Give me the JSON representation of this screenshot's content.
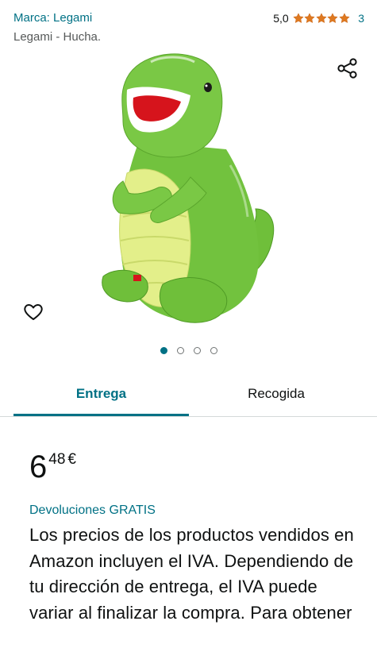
{
  "header": {
    "brand_link": "Marca: Legami",
    "rating_value": "5,0",
    "rating_stars": 5,
    "rating_count": "3",
    "subtitle": "Legami - Hucha."
  },
  "gallery": {
    "image_name": "green dinosaur piggy bank",
    "dots_total": 4,
    "active_dot": 1
  },
  "tabs": [
    {
      "label": "Entrega",
      "active": true
    },
    {
      "label": "Recogida",
      "active": false
    }
  ],
  "price": {
    "whole": "6",
    "fraction": "48",
    "currency": "€"
  },
  "returns_label": "Devoluciones GRATIS",
  "vat_text": "Los precios de los productos vendidos en Amazon incluyen el IVA. Dependiendo de tu dirección de entrega, el IVA puede variar al finalizar la compra. Para obtener",
  "colors": {
    "link": "#007185",
    "star": "#de7921",
    "text": "#0f1111"
  },
  "icons": [
    "share-icon",
    "heart-icon",
    "star-icon"
  ]
}
